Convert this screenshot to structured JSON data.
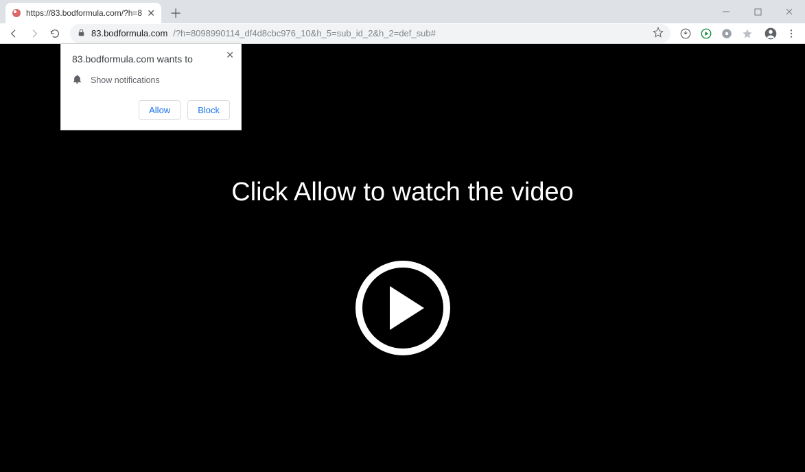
{
  "tab": {
    "title": "https://83.bodformula.com/?h=8"
  },
  "url": {
    "main": "83.bodformula.com",
    "rest": "/?h=8098990114_df4d8cbc976_10&h_5=sub_id_2&h_2=def_sub#"
  },
  "notification_popup": {
    "site_line": "83.bodformula.com wants to",
    "permission_text": "Show notifications",
    "allow_label": "Allow",
    "block_label": "Block"
  },
  "page": {
    "headline": "Click Allow to watch the video"
  }
}
